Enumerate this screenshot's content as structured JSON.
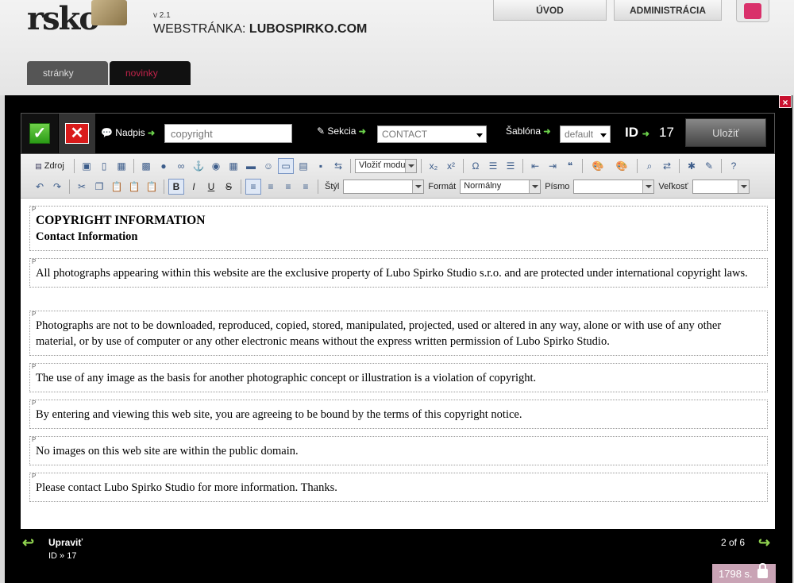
{
  "app": {
    "version": "v 2.1",
    "site_prefix": "WEBSTRÁNKA:",
    "site_name": "LUBOSPIRKO.COM",
    "logo_text": "rsko"
  },
  "topnav": {
    "home": "ÚVOD",
    "admin": "ADMINISTRÁCIA"
  },
  "bg_tabs": {
    "pages": "stránky",
    "news": "novinky"
  },
  "modal": {
    "close": "×",
    "header": {
      "title_label": "Nadpis",
      "title_value": "copyright",
      "section_label": "Sekcia",
      "section_value": "CONTACT",
      "template_label": "Šablóna",
      "template_value": "default",
      "id_label": "ID",
      "id_value": "17",
      "save_label": "Uložiť"
    },
    "toolbar": {
      "source": "Zdroj",
      "insert_module": "Vložiť modul",
      "style_label": "Štýl",
      "style_value": "",
      "format_label": "Formát",
      "format_value": "Normálny",
      "font_label": "Písmo",
      "font_value": "",
      "size_label": "Veľkosť",
      "size_value": ""
    },
    "content": {
      "heading1": "COPYRIGHT INFORMATION",
      "heading2": "Contact Information",
      "p1": "All photographs appearing within this website are the exclusive property of Lubo Spirko Studio s.r.o. and are protected under international copyright laws.",
      "p2": "Photographs are not to be downloaded, reproduced, copied, stored, manipulated, projected, used or altered in any way, alone or with use of any other material, or by use of computer or any other electronic means without the express written permission of Lubo Spirko Studio.",
      "p3": "The use of any image as the basis for another photographic concept or illustration is a violation of copyright.",
      "p4": "By entering and viewing this web site, you are agreeing to be bound by the terms of this copyright notice.",
      "p5": "No images on this web site are within the public domain.",
      "p6": "Please contact Lubo Spirko Studio for more information. Thanks.",
      "ptag": "P"
    },
    "footer": {
      "title": "Upraviť",
      "id_text": "ID » 17",
      "page_text": "2 of 6",
      "timer": "1798 s."
    }
  }
}
